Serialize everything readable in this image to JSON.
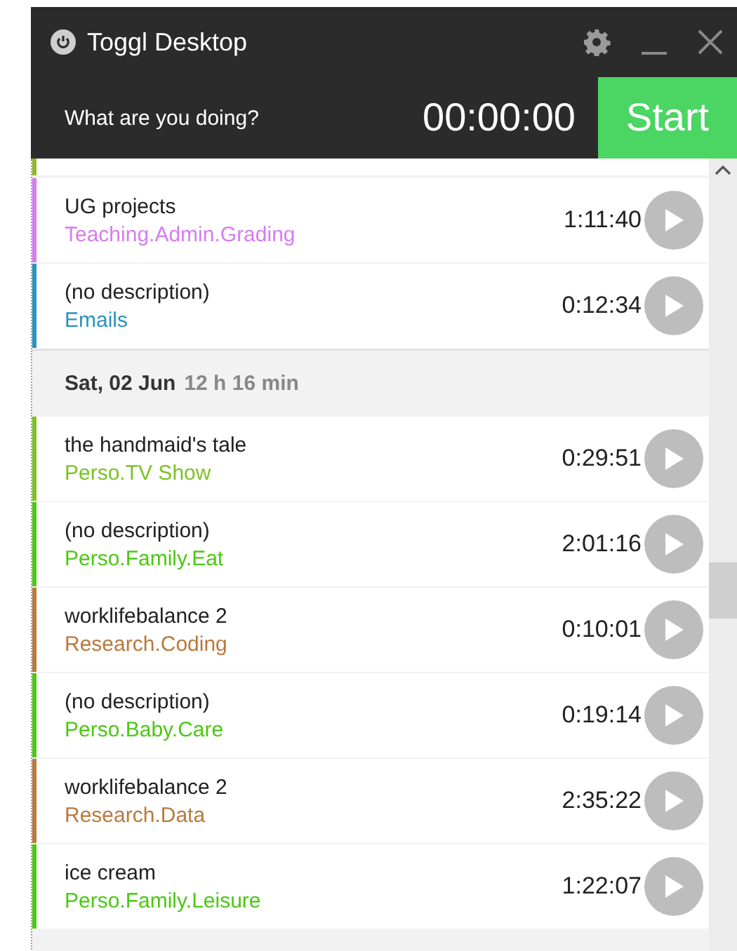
{
  "window": {
    "title": "Toggl Desktop"
  },
  "timer": {
    "placeholder": "What are you doing?",
    "duration": "00:00:00",
    "button": "Start"
  },
  "partial_entry": {
    "color": "#8fb82a"
  },
  "groups": [
    {
      "entries": [
        {
          "description": "UG projects",
          "project": "Teaching.Admin.Grading",
          "duration": "1:11:40",
          "color": "#d67cf2"
        },
        {
          "description": "(no description)",
          "project": "Emails",
          "duration": "0:12:34",
          "color": "#2b93bf"
        }
      ]
    },
    {
      "date": "Sat, 02 Jun",
      "total": "12 h 16 min",
      "entries": [
        {
          "description": "the handmaid's tale",
          "project": "Perso.TV Show",
          "duration": "0:29:51",
          "color": "#7cc225"
        },
        {
          "description": "(no description)",
          "project": "Perso.Family.Eat",
          "duration": "2:01:16",
          "color": "#4cc814"
        },
        {
          "description": "worklifebalance 2",
          "project": "Research.Coding",
          "duration": "0:10:01",
          "color": "#b87a3d"
        },
        {
          "description": "(no description)",
          "project": "Perso.Baby.Care",
          "duration": "0:19:14",
          "color": "#4cc814"
        },
        {
          "description": "worklifebalance 2",
          "project": "Research.Data",
          "duration": "2:35:22",
          "color": "#b87a3d"
        },
        {
          "description": "ice cream",
          "project": "Perso.Family.Leisure",
          "duration": "1:22:07",
          "color": "#4cc814"
        }
      ]
    }
  ]
}
